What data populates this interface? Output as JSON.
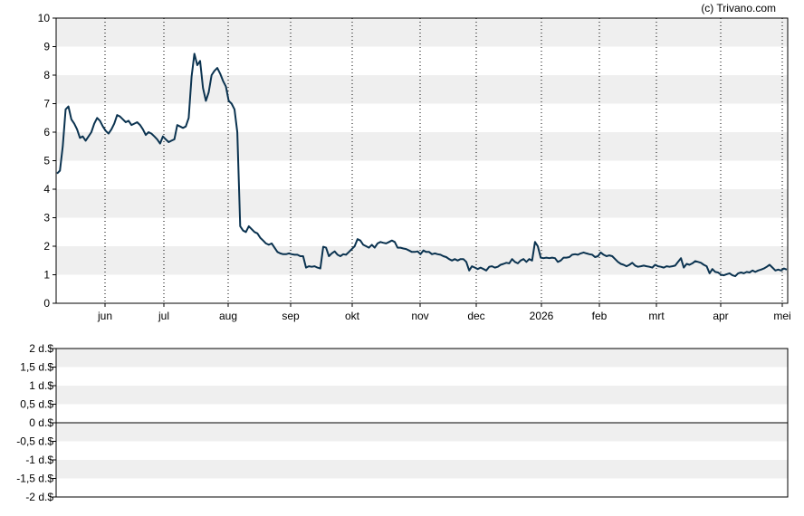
{
  "copyright": "(c) Trivano.com",
  "colors": {
    "line": "#0b3350",
    "band": "#efefef",
    "frame": "#000000",
    "grid": "#000000"
  },
  "chart_data": [
    {
      "type": "line",
      "title": "",
      "xlabel": "",
      "ylabel": "",
      "ylim": [
        0,
        10
      ],
      "y_ticks": [
        "0",
        "1",
        "2",
        "3",
        "4",
        "5",
        "6",
        "7",
        "8",
        "9",
        "10"
      ],
      "x_ticks": [
        "jun",
        "jul",
        "aug",
        "sep",
        "okt",
        "nov",
        "dec",
        "2026",
        "feb",
        "mrt",
        "apr",
        "mei"
      ],
      "grid": "vertical dotted at month starts, alternating horizontal bands",
      "series": [
        {
          "values": [
            [
              0,
              4.55
            ],
            [
              1,
              4.65
            ],
            [
              2,
              5.5
            ],
            [
              3,
              6.8
            ],
            [
              4,
              6.9
            ],
            [
              5,
              6.45
            ],
            [
              6,
              6.3
            ],
            [
              7,
              6.1
            ],
            [
              8,
              5.8
            ],
            [
              9,
              5.85
            ],
            [
              10,
              5.7
            ],
            [
              11,
              5.85
            ],
            [
              12,
              6.0
            ],
            [
              13,
              6.3
            ],
            [
              14,
              6.5
            ],
            [
              15,
              6.4
            ],
            [
              16,
              6.2
            ],
            [
              17,
              6.05
            ],
            [
              18,
              5.95
            ],
            [
              19,
              6.1
            ],
            [
              20,
              6.3
            ],
            [
              21,
              6.6
            ],
            [
              22,
              6.55
            ],
            [
              23,
              6.45
            ],
            [
              24,
              6.35
            ],
            [
              25,
              6.4
            ],
            [
              26,
              6.25
            ],
            [
              27,
              6.3
            ],
            [
              28,
              6.35
            ],
            [
              29,
              6.25
            ],
            [
              30,
              6.1
            ],
            [
              31,
              5.9
            ],
            [
              32,
              6.0
            ],
            [
              33,
              5.95
            ],
            [
              34,
              5.85
            ],
            [
              35,
              5.75
            ],
            [
              36,
              5.6
            ],
            [
              37,
              5.85
            ],
            [
              38,
              5.75
            ],
            [
              39,
              5.65
            ],
            [
              40,
              5.7
            ],
            [
              41,
              5.75
            ],
            [
              42,
              6.25
            ],
            [
              43,
              6.2
            ],
            [
              44,
              6.15
            ],
            [
              45,
              6.2
            ],
            [
              46,
              6.5
            ],
            [
              47,
              7.95
            ],
            [
              48,
              8.75
            ],
            [
              49,
              8.35
            ],
            [
              50,
              8.5
            ],
            [
              51,
              7.55
            ],
            [
              52,
              7.1
            ],
            [
              53,
              7.4
            ],
            [
              54,
              8.0
            ],
            [
              55,
              8.15
            ],
            [
              56,
              8.25
            ],
            [
              57,
              8.05
            ],
            [
              58,
              7.8
            ],
            [
              59,
              7.6
            ],
            [
              60,
              7.1
            ],
            [
              61,
              7.0
            ],
            [
              62,
              6.8
            ],
            [
              63,
              6.0
            ],
            [
              64,
              2.7
            ],
            [
              65,
              2.55
            ],
            [
              66,
              2.5
            ],
            [
              67,
              2.7
            ],
            [
              68,
              2.6
            ],
            [
              69,
              2.5
            ],
            [
              70,
              2.45
            ],
            [
              71,
              2.3
            ],
            [
              72,
              2.2
            ],
            [
              73,
              2.1
            ],
            [
              74,
              2.05
            ],
            [
              75,
              2.1
            ],
            [
              76,
              1.95
            ],
            [
              77,
              1.8
            ],
            [
              78,
              1.75
            ],
            [
              79,
              1.72
            ],
            [
              80,
              1.72
            ],
            [
              81,
              1.75
            ],
            [
              82,
              1.72
            ],
            [
              83,
              1.7
            ],
            [
              84,
              1.7
            ],
            [
              85,
              1.65
            ],
            [
              86,
              1.65
            ],
            [
              87,
              1.25
            ],
            [
              88,
              1.3
            ],
            [
              89,
              1.28
            ],
            [
              90,
              1.3
            ],
            [
              91,
              1.25
            ],
            [
              92,
              1.22
            ],
            [
              93,
              1.98
            ],
            [
              94,
              1.95
            ],
            [
              95,
              1.65
            ],
            [
              96,
              1.75
            ],
            [
              97,
              1.82
            ],
            [
              98,
              1.7
            ],
            [
              99,
              1.65
            ],
            [
              100,
              1.72
            ],
            [
              101,
              1.7
            ],
            [
              102,
              1.8
            ],
            [
              103,
              1.9
            ],
            [
              104,
              2.0
            ],
            [
              105,
              2.25
            ],
            [
              106,
              2.2
            ],
            [
              107,
              2.05
            ],
            [
              108,
              2.0
            ],
            [
              109,
              1.95
            ],
            [
              110,
              2.05
            ],
            [
              111,
              1.95
            ],
            [
              112,
              2.1
            ],
            [
              113,
              2.15
            ],
            [
              114,
              2.12
            ],
            [
              115,
              2.1
            ],
            [
              116,
              2.15
            ],
            [
              117,
              2.2
            ],
            [
              118,
              2.15
            ],
            [
              119,
              1.95
            ],
            [
              120,
              1.95
            ],
            [
              121,
              1.92
            ],
            [
              122,
              1.9
            ],
            [
              123,
              1.85
            ],
            [
              124,
              1.8
            ],
            [
              125,
              1.8
            ],
            [
              126,
              1.82
            ],
            [
              127,
              1.72
            ],
            [
              128,
              1.85
            ],
            [
              129,
              1.8
            ],
            [
              130,
              1.8
            ],
            [
              131,
              1.72
            ],
            [
              132,
              1.75
            ],
            [
              133,
              1.72
            ],
            [
              134,
              1.7
            ],
            [
              135,
              1.65
            ],
            [
              136,
              1.62
            ],
            [
              137,
              1.55
            ],
            [
              138,
              1.5
            ],
            [
              139,
              1.55
            ],
            [
              140,
              1.5
            ],
            [
              141,
              1.55
            ],
            [
              142,
              1.55
            ],
            [
              143,
              1.45
            ],
            [
              144,
              1.15
            ],
            [
              145,
              1.3
            ],
            [
              146,
              1.25
            ],
            [
              147,
              1.2
            ],
            [
              148,
              1.25
            ],
            [
              149,
              1.2
            ],
            [
              150,
              1.15
            ],
            [
              151,
              1.28
            ],
            [
              152,
              1.3
            ],
            [
              153,
              1.25
            ],
            [
              154,
              1.28
            ],
            [
              155,
              1.35
            ],
            [
              156,
              1.38
            ],
            [
              157,
              1.42
            ],
            [
              158,
              1.4
            ],
            [
              159,
              1.55
            ],
            [
              160,
              1.45
            ],
            [
              161,
              1.4
            ],
            [
              162,
              1.5
            ],
            [
              163,
              1.55
            ],
            [
              164,
              1.45
            ],
            [
              165,
              1.55
            ],
            [
              166,
              1.5
            ],
            [
              167,
              2.15
            ],
            [
              168,
              2.0
            ],
            [
              169,
              1.6
            ],
            [
              170,
              1.58
            ],
            [
              171,
              1.6
            ],
            [
              172,
              1.58
            ],
            [
              173,
              1.6
            ],
            [
              174,
              1.58
            ],
            [
              175,
              1.45
            ],
            [
              176,
              1.5
            ],
            [
              177,
              1.6
            ],
            [
              178,
              1.6
            ],
            [
              179,
              1.62
            ],
            [
              180,
              1.7
            ],
            [
              181,
              1.72
            ],
            [
              182,
              1.7
            ],
            [
              183,
              1.75
            ],
            [
              184,
              1.78
            ],
            [
              185,
              1.75
            ],
            [
              186,
              1.72
            ],
            [
              187,
              1.7
            ],
            [
              188,
              1.62
            ],
            [
              189,
              1.65
            ],
            [
              190,
              1.78
            ],
            [
              191,
              1.7
            ],
            [
              192,
              1.65
            ],
            [
              193,
              1.68
            ],
            [
              194,
              1.65
            ],
            [
              195,
              1.55
            ],
            [
              196,
              1.45
            ],
            [
              197,
              1.38
            ],
            [
              198,
              1.35
            ],
            [
              199,
              1.3
            ],
            [
              200,
              1.35
            ],
            [
              201,
              1.42
            ],
            [
              202,
              1.32
            ],
            [
              203,
              1.28
            ],
            [
              204,
              1.3
            ],
            [
              205,
              1.32
            ],
            [
              206,
              1.3
            ],
            [
              207,
              1.28
            ],
            [
              208,
              1.25
            ],
            [
              209,
              1.35
            ],
            [
              210,
              1.3
            ],
            [
              211,
              1.28
            ],
            [
              212,
              1.25
            ],
            [
              213,
              1.3
            ],
            [
              214,
              1.28
            ],
            [
              215,
              1.3
            ],
            [
              216,
              1.32
            ],
            [
              217,
              1.45
            ],
            [
              218,
              1.58
            ],
            [
              219,
              1.25
            ],
            [
              220,
              1.38
            ],
            [
              221,
              1.35
            ],
            [
              222,
              1.4
            ],
            [
              223,
              1.48
            ],
            [
              224,
              1.45
            ],
            [
              225,
              1.42
            ],
            [
              226,
              1.35
            ],
            [
              227,
              1.3
            ],
            [
              228,
              1.05
            ],
            [
              229,
              1.2
            ],
            [
              230,
              1.1
            ],
            [
              231,
              1.08
            ],
            [
              232,
              1.0
            ],
            [
              233,
              0.98
            ],
            [
              234,
              1.02
            ],
            [
              235,
              1.05
            ],
            [
              236,
              0.98
            ],
            [
              237,
              0.95
            ],
            [
              238,
              1.05
            ],
            [
              239,
              1.08
            ],
            [
              240,
              1.05
            ],
            [
              241,
              1.1
            ],
            [
              242,
              1.08
            ],
            [
              243,
              1.15
            ],
            [
              244,
              1.1
            ],
            [
              245,
              1.15
            ],
            [
              246,
              1.18
            ],
            [
              247,
              1.22
            ],
            [
              248,
              1.28
            ],
            [
              249,
              1.35
            ],
            [
              250,
              1.25
            ],
            [
              251,
              1.15
            ],
            [
              252,
              1.18
            ],
            [
              253,
              1.15
            ],
            [
              254,
              1.22
            ],
            [
              255,
              1.18
            ]
          ]
        }
      ]
    },
    {
      "type": "bar",
      "title": "",
      "xlabel": "",
      "ylabel": "",
      "ylim": [
        -2,
        2
      ],
      "y_ticks": [
        "2 d.$",
        "1,5 d.$",
        "1 d.$",
        "0,5 d.$",
        "0 d.$",
        "-0,5 d.$",
        "-1 d.$",
        "-1,5 d.$",
        "-2 d.$"
      ],
      "series": []
    }
  ]
}
